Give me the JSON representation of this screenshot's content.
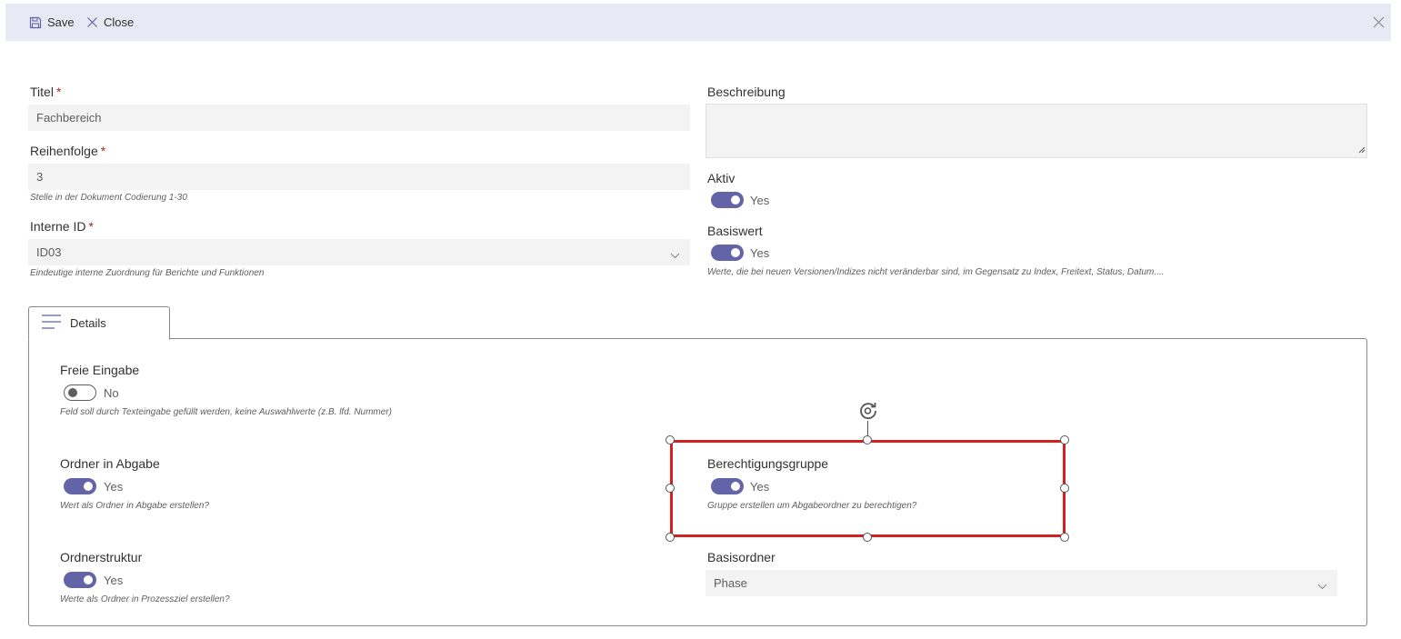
{
  "toolbar": {
    "save_label": "Save",
    "close_label": "Close"
  },
  "form": {
    "titel": {
      "label": "Titel",
      "required": "*",
      "value": "Fachbereich"
    },
    "reihenfolge": {
      "label": "Reihenfolge",
      "required": "*",
      "value": "3",
      "hint": "Stelle in der Dokument Codierung 1-30"
    },
    "interne_id": {
      "label": "Interne ID",
      "required": "*",
      "value": "ID03",
      "hint": "Eindeutige interne Zuordnung für Berichte und Funktionen"
    },
    "beschreibung": {
      "label": "Beschreibung",
      "value": ""
    },
    "aktiv": {
      "label": "Aktiv",
      "state": "Yes",
      "checked": true
    },
    "basiswert": {
      "label": "Basiswert",
      "state": "Yes",
      "checked": true,
      "hint": "Werte, die bei neuen Versionen/Indizes nicht veränderbar sind, im Gegensatz zu Index, Freitext, Status, Datum...."
    }
  },
  "tabs": [
    {
      "label": "Details",
      "icon": "list-icon",
      "selected": true
    }
  ],
  "details": {
    "freie_eingabe": {
      "label": "Freie Eingabe",
      "state": "No",
      "checked": false,
      "hint": "Feld soll durch Texteingabe gefüllt werden, keine Auswahlwerte (z.B. lfd. Nummer)"
    },
    "ordner_in_abgabe": {
      "label": "Ordner in Abgabe",
      "state": "Yes",
      "checked": true,
      "hint": "Wert als Ordner in Abgabe erstellen?"
    },
    "ordnerstruktur": {
      "label": "Ordnerstruktur",
      "state": "Yes",
      "checked": true,
      "hint": "Werte als Ordner in Prozessziel erstellen?"
    },
    "berechtigungsgruppe": {
      "label": "Berechtigungsgruppe",
      "state": "Yes",
      "checked": true,
      "hint": "Gruppe erstellen um Abgabeordner zu berechtigen?"
    },
    "basisordner": {
      "label": "Basisordner",
      "value": "Phase"
    }
  },
  "colors": {
    "accent": "#6264a7",
    "command_bar": "#e9e9f6",
    "selection": "#d0201f",
    "required": "#a4262c"
  }
}
